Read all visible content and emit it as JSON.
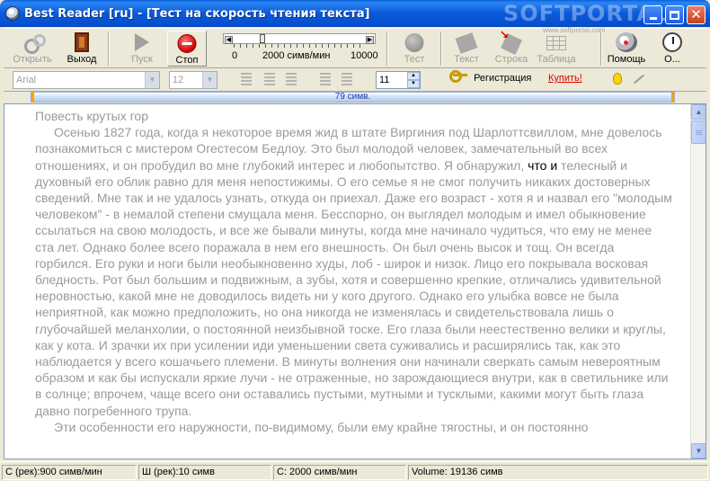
{
  "window": {
    "title": "Best Reader [ru] - [Тест на скорость чтения текста]",
    "watermark": "SOFTPORTAL",
    "watermark_url": "www.softportal.com"
  },
  "toolbar": {
    "open": "Открыть",
    "exit": "Выход",
    "start": "Пуск",
    "stop": "Стоп",
    "test": "Тест",
    "text": "Текст",
    "row": "Строка",
    "table": "Таблица",
    "help": "Помощь",
    "about": "О...",
    "speed_min": "0",
    "speed_value": "2000 симв/мин",
    "speed_max": "10000"
  },
  "format_bar": {
    "font": "Arial",
    "size": "12",
    "line_count": "11",
    "register": "Регистрация",
    "buy": "Купить!"
  },
  "progress": {
    "text": "79 симв.",
    "fraction": 0.004
  },
  "reading": {
    "title": "Повесть крутых гор",
    "p1_before": "Осенью  1827 года,  когда  я некоторое время жид в штате  Виргиния  под Шарлоттсвиллом, мне довелось познакомиться с мистером Огестесом Бедлоу. Это был  молодой человек, замечательный во всех отношениях, и он пробудил во мне глубокий интерес  и любопытство.  Я обнаружил, ",
    "p1_highlight": "что и",
    "p1_after": " телесный и духовный его облик  равно для меня непостижимы.  О его семье  я не  смог получить никаких достоверных сведений. Мне так и не удалось  узнать, откуда он приехал.  Даже его возраст - хотя я и назвал его \"молодым человеком\"  -  в  немалой степени смущала меня. Бесспорно, он выглядел молодым и имел обыкновение ссылаться на свою молодость, и все же бывали минуты, когда мне начинало чудиться, что ему не менее  ста  лет. Однако более всего поражала в нем его  внешность. Он был очень  высок и тощ.  Он всегда горбился. Его руки и ноги были необыкновенно худы, лоб  - широк и низок. Лицо его покрывала восковая  бледность.  Рот был большим и  подвижным,  а  зубы,  хотя  и  совершенно  крепкие, отличались удивительной неровностью, какой мне не доводилось видеть ни у кого  другого. Однако его улыбка вовсе  не была  неприятной, как можно предположить, но она никогда  не изменялась и свидетельствовала лишь о глубочайшей меланхолии, о постоянной неизбывной тоске. Его глаза были неестественно велики и  круглы, как  у кота.  И  зрачки их при  усилении  иди уменьшении  света суживались и расширялись так, как это  наблюдается  у  всего кошачьего племени. В  минуты волнения они начинали сверкать самым невероятным образом и  как бы испускали яркие лучи - не отраженные, но зарождающиеся внутри, как в светильнике или в солнце;  впрочем,  чаще  всего  они оставались пустыми, мутными  и тусклыми, какими могут быть глаза давно погребенного трупа.",
    "p2": "Эти особенности его наружности, по-видимому,  были ему крайне тягостны, и он постоянно"
  },
  "status": {
    "rec_speed": "С (рек):900 симв/мин",
    "rec_width": "Ш (рек):10 симв",
    "speed": "С: 2000 симв/мин",
    "volume": "Volume: 19136 симв"
  },
  "colors": {
    "accent": "#0a5ad8",
    "read_text": "#9a9a9a",
    "highlight_text": "#000000",
    "buy_link": "#dd0000"
  }
}
